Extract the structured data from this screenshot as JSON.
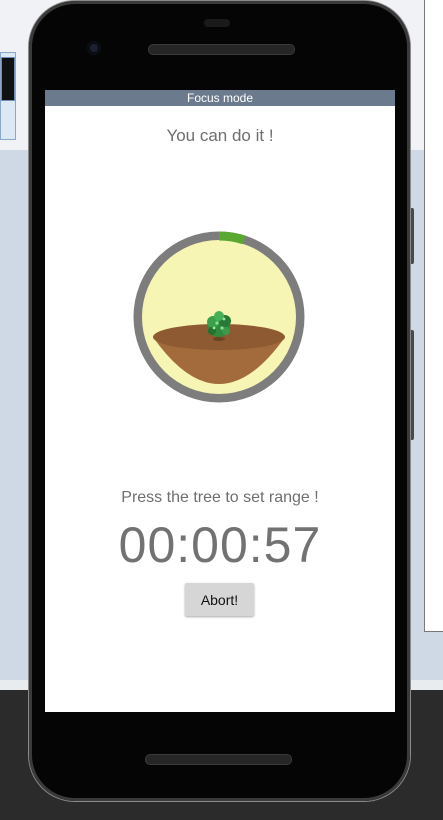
{
  "app": {
    "title": "Focus mode"
  },
  "focus": {
    "motivation_text": "You can do it !",
    "instruction_text": "Press the tree to set range !",
    "timer_value": "00:00:57",
    "abort_label": "Abort!",
    "progress_fraction": 0.05
  },
  "colors": {
    "titlebar": "#6b7b8d",
    "ring_track": "#7d7d7d",
    "ring_progress": "#5aa832",
    "sky": "#f7f5b4",
    "soil": "#a36b3b",
    "tree": "#2e8b3e"
  },
  "icons": {
    "tree": "tree-sapling-icon"
  }
}
